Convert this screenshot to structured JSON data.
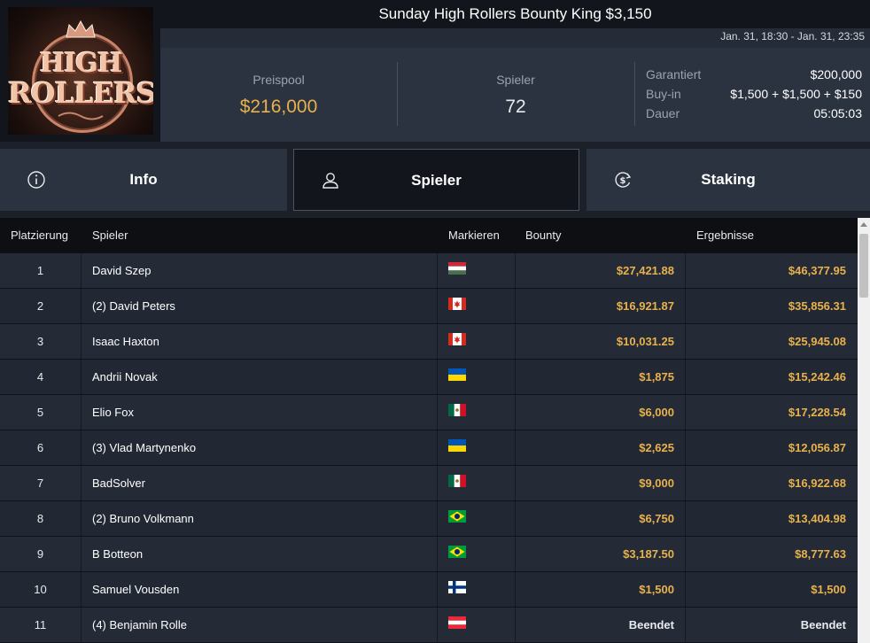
{
  "header": {
    "title": "Sunday High Rollers Bounty King $3,150",
    "dates": "Jan. 31, 18:30 - Jan. 31, 23:35",
    "logo": {
      "line1": "HIGH",
      "line2": "ROLLERS"
    }
  },
  "stats": {
    "prize_pool_label": "Preispool",
    "prize_pool_value": "$216,000",
    "players_label": "Spieler",
    "players_value": "72",
    "guaranteed_label": "Garantiert",
    "guaranteed_value": "$200,000",
    "buyin_label": "Buy-in",
    "buyin_value": "$1,500 + $1,500 + $150",
    "duration_label": "Dauer",
    "duration_value": "05:05:03"
  },
  "tabs": [
    {
      "label": "Info",
      "icon": "info-icon"
    },
    {
      "label": "Spieler",
      "icon": "user-icon"
    },
    {
      "label": "Staking",
      "icon": "dollar-cycle-icon"
    }
  ],
  "active_tab": "Spieler",
  "table": {
    "headers": {
      "rank": "Platzierung",
      "player": "Spieler",
      "flag": "Markieren",
      "bounty": "Bounty",
      "result": "Ergebnisse"
    },
    "rows": [
      {
        "rank": "1",
        "name": "David Szep",
        "flag": "hungary",
        "bounty": "$27,421.88",
        "result": "$46,377.95"
      },
      {
        "rank": "2",
        "name": "(2) David Peters",
        "flag": "canada",
        "bounty": "$16,921.87",
        "result": "$35,856.31"
      },
      {
        "rank": "3",
        "name": "Isaac Haxton",
        "flag": "canada",
        "bounty": "$10,031.25",
        "result": "$25,945.08"
      },
      {
        "rank": "4",
        "name": "Andrii Novak",
        "flag": "ukraine",
        "bounty": "$1,875",
        "result": "$15,242.46"
      },
      {
        "rank": "5",
        "name": "Elio Fox",
        "flag": "mexico",
        "bounty": "$6,000",
        "result": "$17,228.54"
      },
      {
        "rank": "6",
        "name": "(3) Vlad Martynenko",
        "flag": "ukraine",
        "bounty": "$2,625",
        "result": "$12,056.87"
      },
      {
        "rank": "7",
        "name": "BadSolver",
        "flag": "mexico",
        "bounty": "$9,000",
        "result": "$16,922.68"
      },
      {
        "rank": "8",
        "name": "(2) Bruno Volkmann",
        "flag": "brazil",
        "bounty": "$6,750",
        "result": "$13,404.98"
      },
      {
        "rank": "9",
        "name": "B Botteon",
        "flag": "brazil",
        "bounty": "$3,187.50",
        "result": "$8,777.63"
      },
      {
        "rank": "10",
        "name": "Samuel Vousden",
        "flag": "finland",
        "bounty": "$1,500",
        "result": "$1,500"
      },
      {
        "rank": "11",
        "name": "(4) Benjamin Rolle",
        "flag": "austria",
        "bounty": "Beendet",
        "result": "Beendet"
      }
    ]
  },
  "colors": {
    "accent_gold": "#e8b14c",
    "background": "#1b2029",
    "panel": "#2b3340"
  }
}
